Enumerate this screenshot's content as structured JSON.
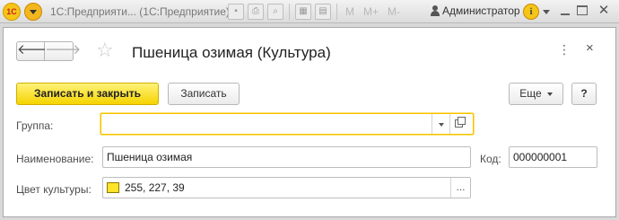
{
  "app": {
    "logo_text": "1С",
    "title": "1С:Предприяти... (1С:Предприятие)",
    "user": "Администратор",
    "memory_buttons": [
      "M",
      "M+",
      "M-"
    ],
    "icons": [
      "save-icon",
      "print-icon",
      "preview-icon",
      "calculator-icon",
      "calendar-icon",
      "info-icon",
      "minimize-icon",
      "maximize-icon",
      "close-icon"
    ]
  },
  "form": {
    "title": "Пшеница озимая (Культура)",
    "nav": {
      "back": "🡐",
      "forward": "🡒"
    },
    "more_dots": "⋮",
    "close_glyph": "×"
  },
  "toolbar": {
    "save_close_label": "Записать и закрыть",
    "save_label": "Записать",
    "more_label": "Еще",
    "help_label": "?"
  },
  "fields": {
    "group": {
      "label": "Группа:",
      "value": ""
    },
    "name": {
      "label": "Наименование:",
      "value": "Пшеница озимая"
    },
    "code": {
      "label": "Код:",
      "value": "000000001"
    },
    "color": {
      "label": "Цвет культуры:",
      "value": "255, 227, 39",
      "swatch_color": "#FFE327",
      "select_label": "..."
    }
  },
  "colors": {
    "primary_button": "#F5D400",
    "focus_border": "#F2C200",
    "logo": "#F5C518"
  }
}
